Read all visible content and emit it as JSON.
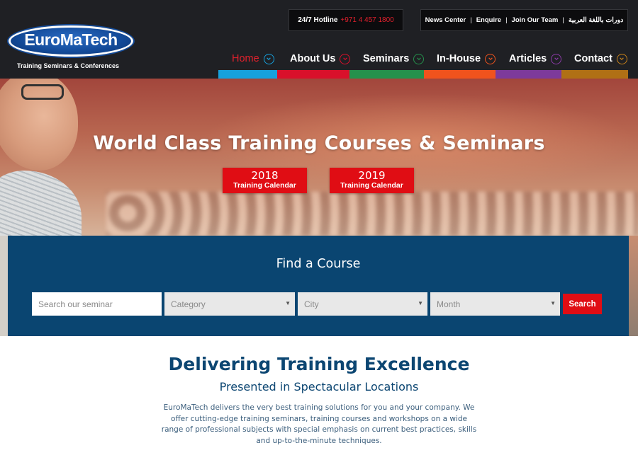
{
  "brand": {
    "logo_text": "EuroMaTech",
    "tagline": "Training Seminars & Conferences"
  },
  "topbar": {
    "hotline_label": "24/7 Hotline",
    "hotline_number": "+971 4 457 1800",
    "links": [
      "News Center",
      "Enquire",
      "Join Our Team",
      "دورات باللغة العربية"
    ]
  },
  "nav": {
    "items": [
      {
        "label": "Home",
        "color": "#e0202c",
        "strip": "#16a1dd"
      },
      {
        "label": "About Us",
        "color": "#e0202c",
        "strip": "#d9102b"
      },
      {
        "label": "Seminars",
        "color": "#2a9a4b",
        "strip": "#25914c"
      },
      {
        "label": "In-House",
        "color": "#f0591e",
        "strip": "#f0531d"
      },
      {
        "label": "Articles",
        "color": "#8b3aa6",
        "strip": "#7d3a9b"
      },
      {
        "label": "Contact",
        "color": "#c7821b",
        "strip": "#b07015"
      }
    ]
  },
  "hero": {
    "title": "World Class Training Courses & Seminars",
    "calendars": [
      {
        "year": "2018",
        "label": "Training Calendar"
      },
      {
        "year": "2019",
        "label": "Training Calendar"
      }
    ]
  },
  "finder": {
    "title": "Find a Course",
    "search_placeholder": "Search our seminar",
    "category": "Category",
    "city": "City",
    "month": "Month",
    "search_button": "Search"
  },
  "intro": {
    "title": "Delivering Training Excellence",
    "subtitle": "Presented in Spectacular Locations",
    "body": "EuroMaTech delivers the very best training solutions for you and your company. We offer cutting-edge training seminars, training courses and workshops on a wide range of professional subjects with special emphasis on current best practices, skills and up-to-the-minute techniques."
  },
  "colors": {
    "header_bg": "#1f2024",
    "accent_red": "#e00d14",
    "navy": "#0a4571"
  }
}
